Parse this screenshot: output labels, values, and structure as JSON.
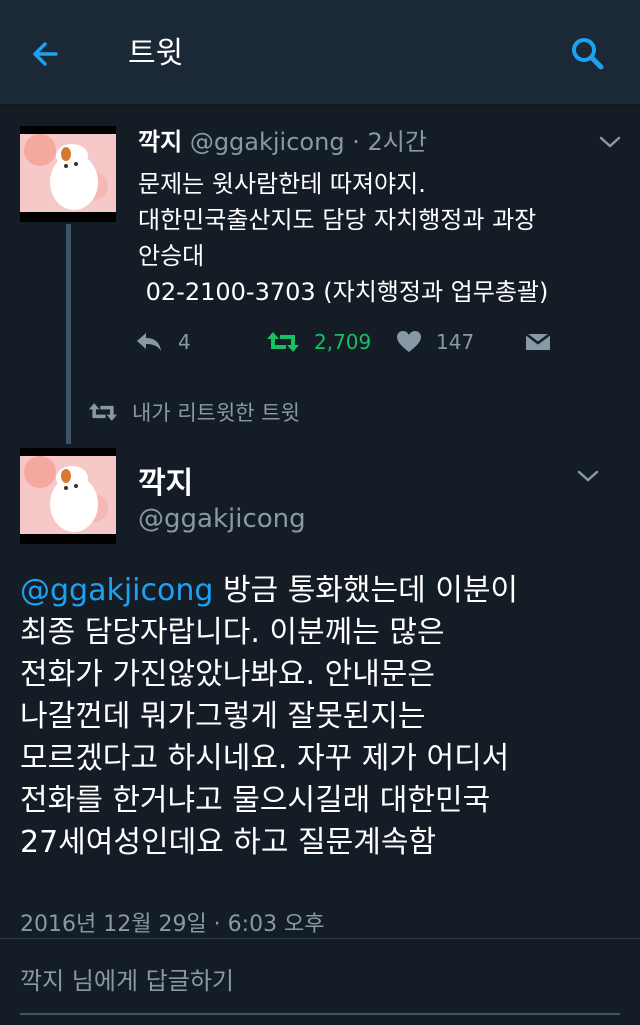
{
  "header": {
    "title": "트윗",
    "back_icon": "arrow-left-icon",
    "search_icon": "search-icon"
  },
  "colors": {
    "background": "#141d26",
    "header_bg": "#1b2836",
    "accent": "#1da1f2",
    "retweet_green": "#17bf63",
    "muted": "#8899a6"
  },
  "tweet1": {
    "name": "깍지",
    "handle": "@ggakjicong",
    "separator": "·",
    "time": "2시간",
    "lines": [
      "문제는 윗사람한테 따져야지.",
      "대한민국출산지도 담당 자치행정과 과장",
      "안승대",
      " 02-2100-3703 (자치행정과 업무총괄)"
    ],
    "reply_count": "4",
    "retweet_count": "2,709",
    "like_count": "147"
  },
  "retweet_note": "내가 리트윗한 트윗",
  "tweet2": {
    "name": "깍지",
    "handle": "@ggakjicong",
    "mention": "@ggakjicong",
    "line1_rest": " 방금 통화했는데 이분이",
    "lines": [
      "최종 담당자랍니다. 이분께는 많은",
      "전화가 가진않았나봐요. 안내문은",
      "나갈껀데 뭐가그렇게 잘못된지는",
      "모르겠다고 하시네요. 자꾸 제가 어디서",
      "전화를 한거냐고 물으시길래 대한민국",
      "27세여성인데요 하고 질문계속함"
    ],
    "timestamp": "2016년 12월 29일 · 6:03 오후"
  },
  "reply": {
    "placeholder": "깍지 님에게 답글하기"
  }
}
